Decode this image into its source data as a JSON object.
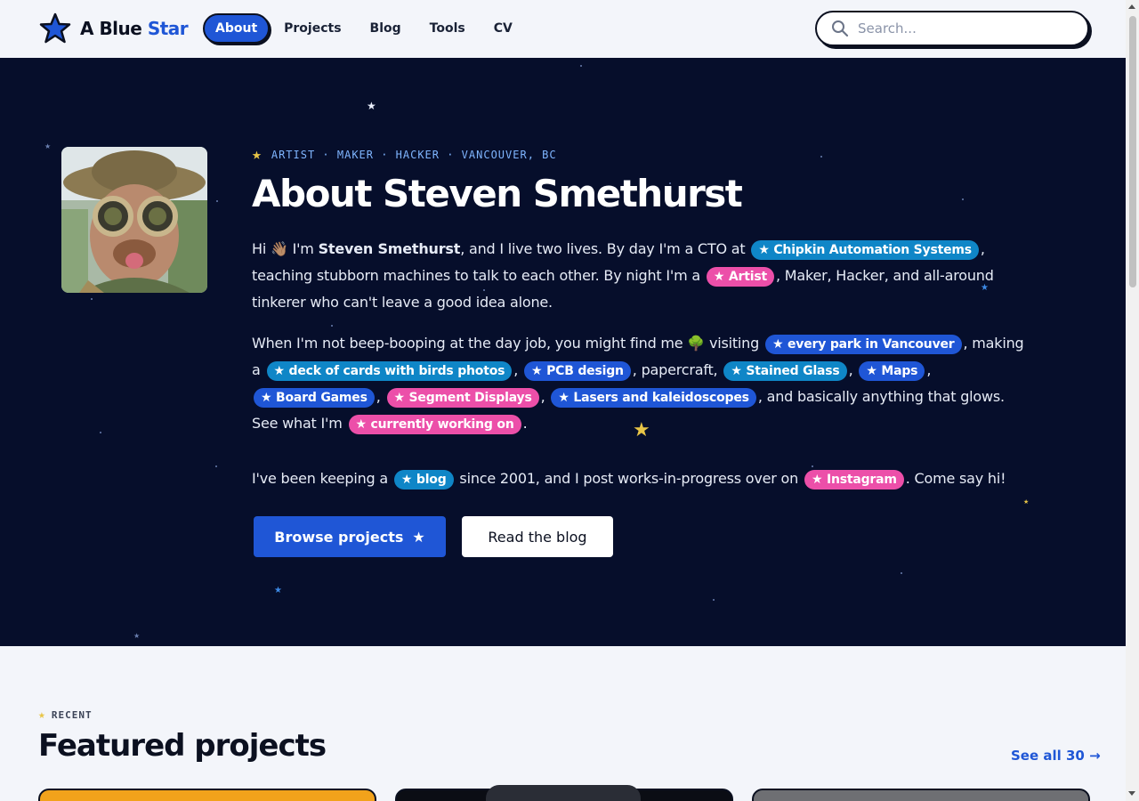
{
  "brand": {
    "name_part1": "A Blue",
    "name_part2": "Star"
  },
  "nav": {
    "items": [
      {
        "label": "About",
        "active": true
      },
      {
        "label": "Projects"
      },
      {
        "label": "Blog"
      },
      {
        "label": "Tools"
      },
      {
        "label": "CV"
      }
    ]
  },
  "search": {
    "placeholder": "Search..."
  },
  "hero": {
    "eyebrow": "ARTIST · MAKER · HACKER · VANCOUVER, BC",
    "title": "About Steven Smethurst",
    "p1": {
      "hi": "Hi ",
      "wave": "👋🏽",
      "im": " I'm ",
      "name": "Steven Smethurst",
      "t1": ", and I live two lives. By day I'm a CTO at ",
      "company": "★ Chipkin Automation Systems",
      "t2": ", teaching stubborn machines to talk to each other. By night I'm a ",
      "artist": "★ Artist",
      "t3": ", Maker, Hacker, and all-around tinkerer who can't leave a good idea alone."
    },
    "p2": {
      "t1": "When I'm not beep-booping at the day job, you might find me ",
      "tree": "🌳",
      "t2": " visiting ",
      "parks": "★ every park in Vancouver",
      "t3": ", making a ",
      "cards": "★ deck of cards with birds photos",
      "c1": ", ",
      "pcb": "★ PCB design",
      "t4": ", papercraft, ",
      "glass": "★ Stained Glass",
      "c2": ", ",
      "maps": "★ Maps",
      "c3": ", ",
      "games": "★ Board Games",
      "c4": ", ",
      "segment": "★ Segment Displays",
      "c5": ", ",
      "lasers": "★ Lasers and kaleidoscopes",
      "t5": ", and basically anything that glows. See what I'm ",
      "working": "★ currently working on",
      "t6": "."
    },
    "p3": {
      "t1": "I've been keeping a ",
      "blog": "★ blog",
      "t2": " since 2001, and I post works-in-progress over on ",
      "instagram": "★ Instagram",
      "t3": ". Come say hi!"
    },
    "btn_primary": "Browse projects",
    "btn_primary_star": "★",
    "btn_secondary": "Read the blog"
  },
  "featured": {
    "eyebrow_star": "★",
    "eyebrow": "RECENT",
    "title": "Featured projects",
    "see_all": "See all 30 →"
  },
  "colors": {
    "accent": "#1f56d6",
    "hero_bg": "#060e2b",
    "pill_cyan": "#0f86c7",
    "pill_pink": "#ec4fa9",
    "star_yellow": "#e8c547"
  }
}
